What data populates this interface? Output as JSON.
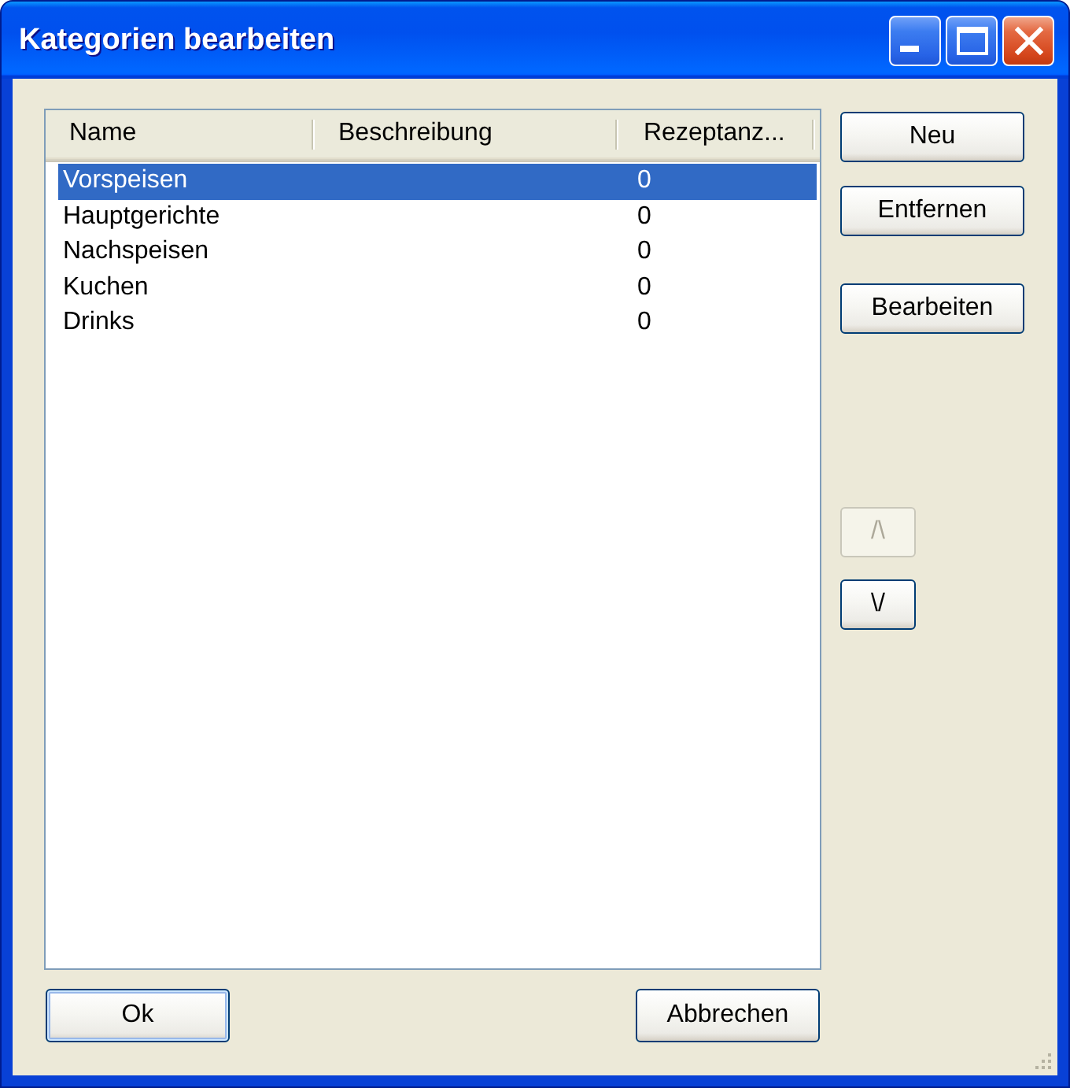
{
  "window": {
    "title": "Kategorien bearbeiten"
  },
  "list": {
    "columns": [
      "Name",
      "Beschreibung",
      "Rezeptanz..."
    ],
    "rows": [
      {
        "name": "Vorspeisen",
        "count": "0",
        "selected": true
      },
      {
        "name": "Hauptgerichte",
        "count": "0",
        "selected": false
      },
      {
        "name": "Nachspeisen",
        "count": "0",
        "selected": false
      },
      {
        "name": "Kuchen",
        "count": "0",
        "selected": false
      },
      {
        "name": "Drinks",
        "count": "0",
        "selected": false
      }
    ]
  },
  "actions": [
    {
      "label": "Neu",
      "disabled": false
    },
    {
      "label": "Entfernen",
      "disabled": false
    },
    {
      "label": "Bearbeiten",
      "disabled": false
    }
  ],
  "order_buttons": [
    {
      "label": "/\\",
      "disabled": true
    },
    {
      "label": "\\/",
      "disabled": false
    }
  ],
  "footer_buttons": [
    {
      "label": "Ok",
      "default": true
    },
    {
      "label": "Abbrechen",
      "default": false
    }
  ]
}
